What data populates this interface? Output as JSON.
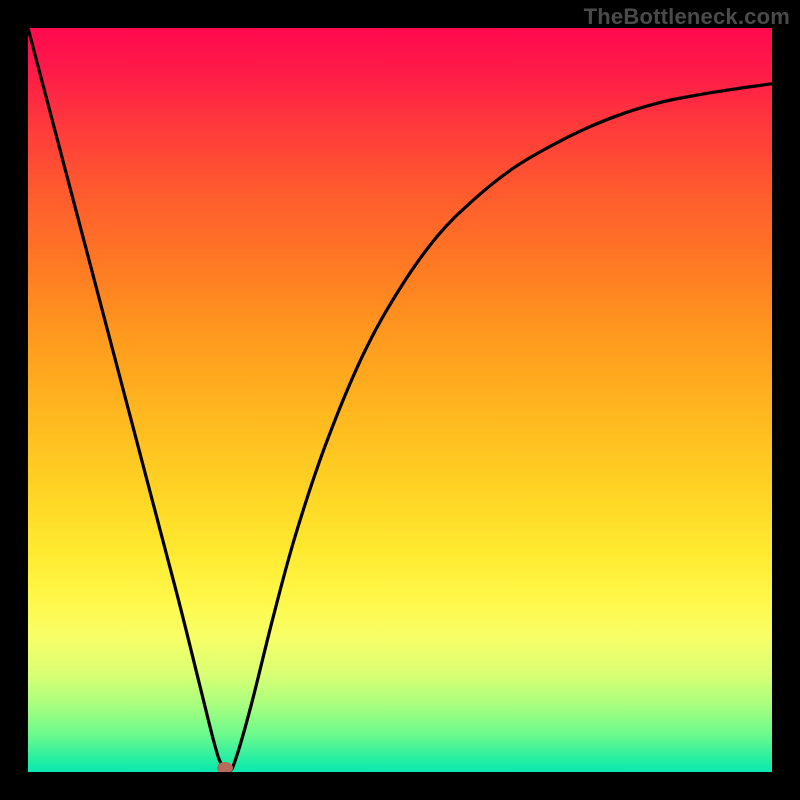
{
  "watermark": "TheBottleneck.com",
  "colors": {
    "frame": "#000000",
    "curve": "#000000",
    "marker": "#b96a5e"
  },
  "chart_data": {
    "type": "line",
    "title": "",
    "xlabel": "",
    "ylabel": "",
    "xlim": [
      0,
      100
    ],
    "ylim": [
      0,
      100
    ],
    "grid": false,
    "legend": false,
    "series": [
      {
        "name": "bottleneck-curve",
        "x": [
          0,
          5,
          10,
          15,
          20,
          23,
          25,
          26,
          27,
          28,
          30,
          33,
          36,
          40,
          45,
          50,
          55,
          60,
          65,
          70,
          75,
          80,
          85,
          90,
          95,
          100
        ],
        "y": [
          100,
          81,
          62,
          43,
          24,
          12,
          4,
          1,
          0,
          2,
          9,
          21,
          32,
          44,
          56,
          65,
          72,
          77,
          81,
          84,
          86.5,
          88.5,
          90,
          91,
          91.8,
          92.5
        ]
      }
    ],
    "marker": {
      "x": 26.5,
      "y": 0.5
    },
    "gradient_stops": [
      {
        "pos": 0,
        "color": "#ff0a4f"
      },
      {
        "pos": 14,
        "color": "#ff3d3a"
      },
      {
        "pos": 32,
        "color": "#ff7a23"
      },
      {
        "pos": 52,
        "color": "#ffb81f"
      },
      {
        "pos": 70,
        "color": "#ffe92f"
      },
      {
        "pos": 82,
        "color": "#f7ff67"
      },
      {
        "pos": 91,
        "color": "#a8ff7e"
      },
      {
        "pos": 100,
        "color": "#08e8b0"
      }
    ]
  }
}
